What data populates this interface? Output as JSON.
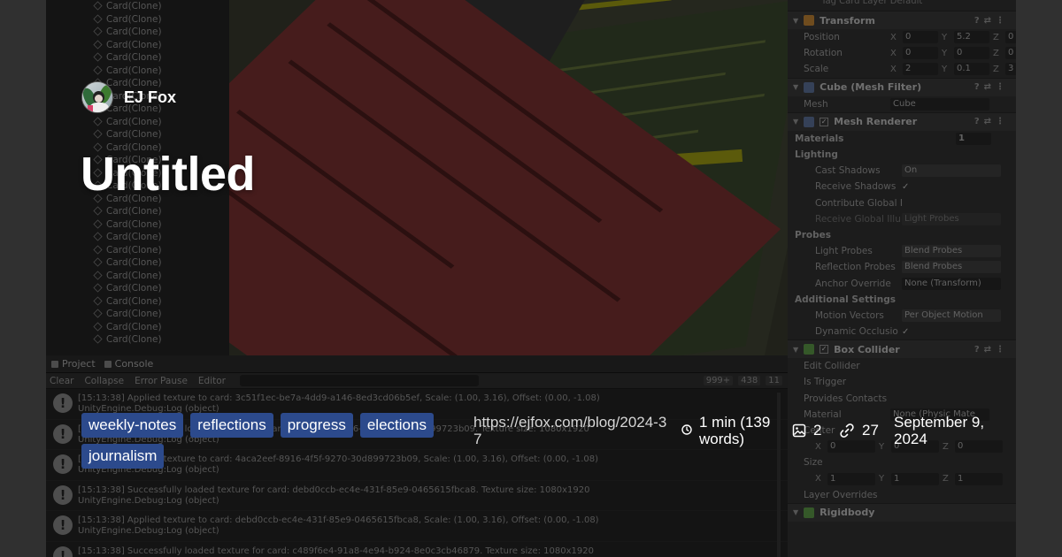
{
  "unity": {
    "hierarchy": {
      "row_label": "Card(Clone)",
      "row_count": 27
    },
    "console": {
      "tabs": [
        "Project",
        "Console"
      ],
      "toolbar": [
        "Clear",
        "Collapse",
        "Error Pause",
        "Editor"
      ],
      "counts": {
        "info": "999+",
        "warn": "438",
        "error": "11"
      },
      "logs": [
        {
          "line1": "[15:13:38] Applied texture to card: 3c51f1ec-be7a-4dd9-a146-8ed3cd06b5ef, Scale: (1.00, 3.16), Offset: (0.00, -1.08)",
          "line2": "UnityEngine.Debug:Log (object)"
        },
        {
          "line1": "[15:13:38] Successfully loaded texture for card: 4aca2eef-8916-4f5f-9270-30d899723b09. Texture size: 1080x1920",
          "line2": "UnityEngine.Debug:Log (object)"
        },
        {
          "line1": "[15:13:38] Applied texture to card: 4aca2eef-8916-4f5f-9270-30d899723b09, Scale: (1.00, 3.16), Offset: (0.00, -1.08)",
          "line2": "UnityEngine.Debug:Log (object)"
        },
        {
          "line1": "[15:13:38] Successfully loaded texture for card: debd0ccb-ec4e-431f-85e9-0465615fbca8. Texture size: 1080x1920",
          "line2": "UnityEngine.Debug:Log (object)"
        },
        {
          "line1": "[15:13:38] Applied texture to card: debd0ccb-ec4e-431f-85e9-0465615fbca8, Scale: (1.00, 3.16), Offset: (0.00, -1.08)",
          "line2": "UnityEngine.Debug:Log (object)"
        },
        {
          "line1": "[15:13:38] Successfully loaded texture for card: c489f6e4-91a8-4e94-b924-8e0c3cb46879. Texture size: 1080x1920",
          "line2": ""
        }
      ]
    },
    "inspector": {
      "top_text": "Tag  Card        Layer  Default",
      "transform": {
        "header": "Transform",
        "position_label": "Position",
        "position": [
          "0",
          "5.2",
          "0"
        ],
        "rotation_label": "Rotation",
        "rotation": [
          "0",
          "0",
          "0"
        ],
        "scale_label": "Scale",
        "scale": [
          "2",
          "0.1",
          "3"
        ]
      },
      "mesh_filter": {
        "header": "Cube (Mesh Filter)",
        "mesh_label": "Mesh",
        "mesh_value": "Cube"
      },
      "mesh_renderer": {
        "header": "Mesh Renderer",
        "materials_label": "Materials",
        "materials_value": "1",
        "lighting_label": "Lighting",
        "cast_shadows_label": "Cast Shadows",
        "cast_shadows_value": "On",
        "receive_shadows_label": "Receive Shadows",
        "contribute_gi_label": "Contribute Global I",
        "receive_gi_label": "Receive Global Illu",
        "receive_gi_value": "Light Probes",
        "probes_label": "Probes",
        "light_probes_label": "Light Probes",
        "light_probes_value": "Blend Probes",
        "reflection_probes_label": "Reflection Probes",
        "reflection_probes_value": "Blend Probes",
        "anchor_override_label": "Anchor Override",
        "anchor_override_value": "None (Transform)",
        "additional_label": "Additional Settings",
        "motion_vectors_label": "Motion Vectors",
        "motion_vectors_value": "Per Object Motion",
        "dynamic_occlusion_label": "Dynamic Occlusio"
      },
      "box_collider": {
        "header": "Box Collider",
        "edit_collider_label": "Edit Collider",
        "is_trigger_label": "Is Trigger",
        "provides_contacts_label": "Provides Contacts",
        "material_label": "Material",
        "material_value": "None (Physic Mate",
        "center_label": "Center",
        "center": [
          "0",
          "0",
          "0"
        ],
        "size_label": "Size",
        "size": [
          "1",
          "1",
          "1"
        ],
        "layer_overrides_label": "Layer Overrides"
      },
      "rigidbody": {
        "header": "Rigidbody"
      }
    }
  },
  "post": {
    "author": "EJ Fox",
    "title": "Untitled",
    "tags": [
      "weekly-notes",
      "reflections",
      "progress",
      "elections",
      "journalism"
    ],
    "url": "https://ejfox.com/blog/2024-37",
    "reading_time": "1 min (139 words)",
    "image_count": "2",
    "link_count": "27",
    "date": "September 9, 2024"
  },
  "colors": {
    "tag_bg": "#2c4a8c",
    "title_text": "#ffffff"
  },
  "icons": [
    "cube-icon",
    "clock-icon",
    "image-icon",
    "link-icon",
    "info-icon"
  ]
}
